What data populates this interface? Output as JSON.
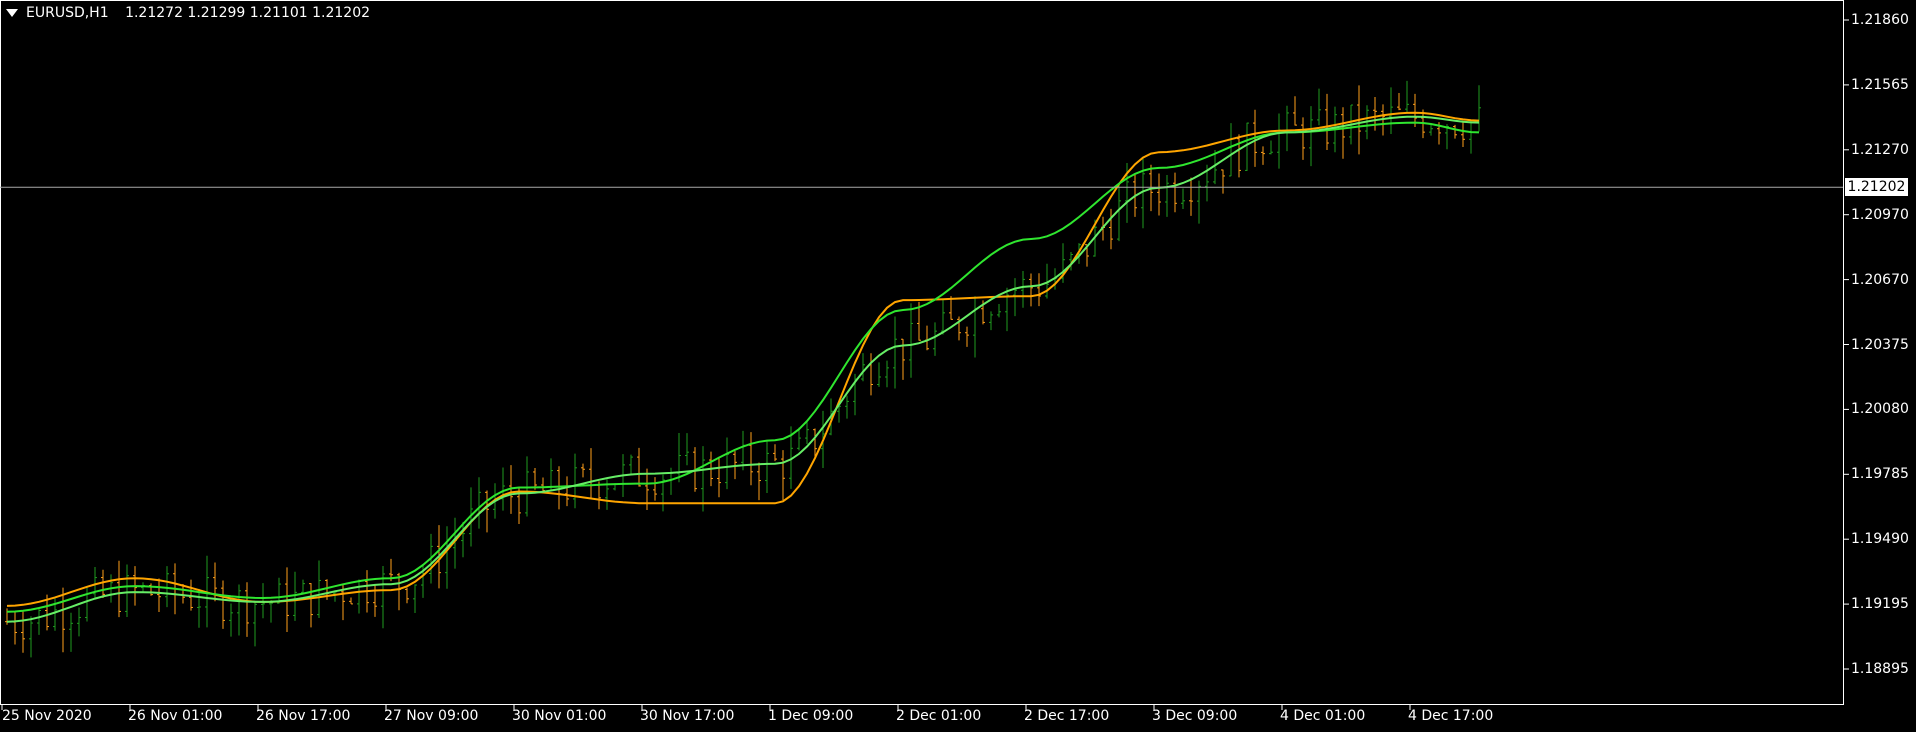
{
  "header": {
    "symbol": "EURUSD,H1",
    "ohlc": "1.21272 1.21299 1.21101 1.21202"
  },
  "colors": {
    "background": "#000000",
    "axis": "#ffffff",
    "bull_bar": "#1f9c1f",
    "bear_bar": "#ff9f1a",
    "ma_fast": "#ffa500",
    "ma_mid": "#66ee66",
    "ma_slow": "#2fe62f",
    "bid_line": "#a9a9a9"
  },
  "chart_data": {
    "type": "line",
    "title": "EURUSD,H1",
    "y_ticks": [
      "1.21860",
      "1.21565",
      "1.21270",
      "1.20970",
      "1.20670",
      "1.20375",
      "1.20080",
      "1.19785",
      "1.19490",
      "1.19195",
      "1.18895"
    ],
    "ylim": [
      1.1876,
      1.2205
    ],
    "x_ticks": [
      "25 Nov 2020",
      "26 Nov 01:00",
      "26 Nov 17:00",
      "27 Nov 09:00",
      "30 Nov 01:00",
      "30 Nov 17:00",
      "1 Dec 09:00",
      "2 Dec 01:00",
      "2 Dec 17:00",
      "3 Dec 09:00",
      "4 Dec 01:00",
      "4 Dec 17:00"
    ],
    "bars_per_x_tick": 16,
    "current_price": "1.21202",
    "series": [
      {
        "x": [
          0,
          16,
          32,
          48,
          64,
          80,
          96,
          112,
          128,
          144,
          160,
          176,
          184
        ],
        "values": [
          1.1908,
          1.1922,
          1.191,
          1.1916,
          1.1966,
          1.196,
          1.196,
          1.2063,
          1.2065,
          1.2138,
          1.2149,
          1.2158,
          1.2154
        ]
      },
      {
        "x": [
          0,
          16,
          32,
          48,
          64,
          80,
          96,
          112,
          128,
          144,
          160,
          176,
          184
        ],
        "values": [
          1.1905,
          1.1918,
          1.1912,
          1.1922,
          1.1968,
          1.197,
          1.1992,
          1.2058,
          1.2094,
          1.213,
          1.2148,
          1.2153,
          1.2148
        ]
      },
      {
        "x": [
          0,
          16,
          32,
          48,
          64,
          80,
          96,
          112,
          128,
          144,
          160,
          176,
          184
        ],
        "values": [
          1.19,
          1.1915,
          1.191,
          1.1919,
          1.1965,
          1.1975,
          1.198,
          1.204,
          1.207,
          1.212,
          1.2148,
          1.2156,
          1.2153
        ]
      }
    ]
  }
}
